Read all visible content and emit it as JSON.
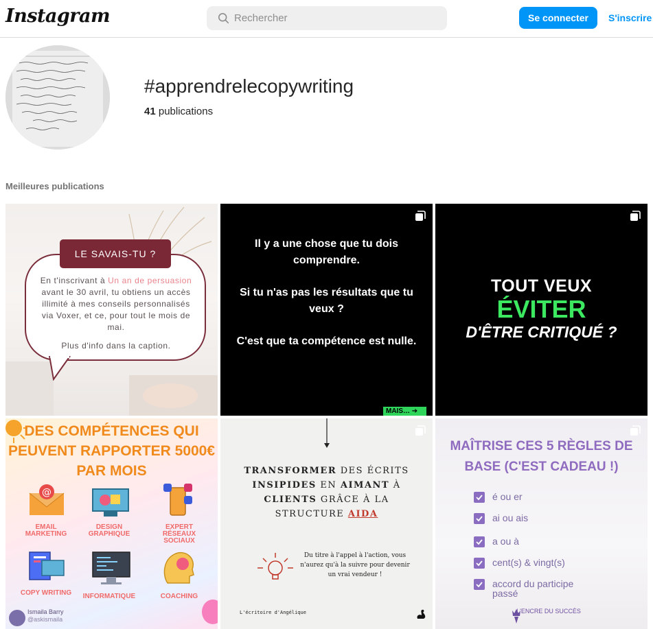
{
  "header": {
    "logo": "Instagram",
    "search_placeholder": "Rechercher",
    "login_label": "Se connecter",
    "signup_label": "S'inscrire"
  },
  "hashtag": {
    "title": "#apprendrelecopywriting",
    "count": "41",
    "count_suffix": " publications"
  },
  "section_label": "Meilleures publications",
  "posts": [
    {
      "pill": "LE SAVAIS-TU ?",
      "body_before": "En t'inscrivant à ",
      "body_highlight": "Un an de persuasion",
      "body_after": " avant le 30 avril, tu obtiens un accès illimité à mes conseils personnalisés via Voxer, et ce, pour tout le mois de mai.",
      "more": "Plus d'info dans la caption."
    },
    {
      "p1": "Il y a une chose que tu dois comprendre.",
      "p2": "Si tu n'as pas les résultats que tu veux ?",
      "p3": "C'est que ta compétence est nulle.",
      "mais": "MAIS… ➔"
    },
    {
      "l1": "TOUT VEUX",
      "l2": "ÉVITER",
      "l3": "D'ÊTRE CRITIQUÉ ?"
    },
    {
      "heading": "DES COMPÉTENCES QUI PEUVENT RAPPORTER 5000€ PAR MOIS",
      "skills": [
        "EMAIL MARKETING",
        "DESIGN GRAPHIQUE",
        "EXPERT RÉSEAUX SOCIAUX",
        "COPY WRITING",
        "INFORMATIQUE",
        "COACHING"
      ],
      "author_name": "Ismaila Barry",
      "author_handle": "@askismaila"
    },
    {
      "t_word1": "TRANSFORMER",
      "t_rest1": " DES ÉCRITS",
      "t_word2": "INSIPIDES",
      "t_mid2": " EN ",
      "t_word3": "AIMANT",
      "t_end2": " À",
      "t_word4": "CLIENTS",
      "t_rest3": " GRÂCE À LA",
      "t_line4": "STRUCTURE ",
      "t_aida": "AIDA",
      "desc": "Du titre à l'appel à l'action, vous n'aurez qu'à la suivre pour devenir un vrai vendeur !",
      "signature": "L'écritoire d'Angélique"
    },
    {
      "heading": "MAÎTRISE CES 5 RÈGLES DE BASE (C'EST CADEAU !)",
      "rules": [
        "é ou er",
        "ai ou ais",
        "a ou à",
        "cent(s) & vingt(s)",
        "accord du participe passé"
      ],
      "brand": "L'ENCRE DU SUCCÈS"
    }
  ],
  "colors": {
    "accent_blue": "#0095f6",
    "burgundy": "#7a2736",
    "neon_green": "#3be85f",
    "purple": "#8e6bbf"
  }
}
